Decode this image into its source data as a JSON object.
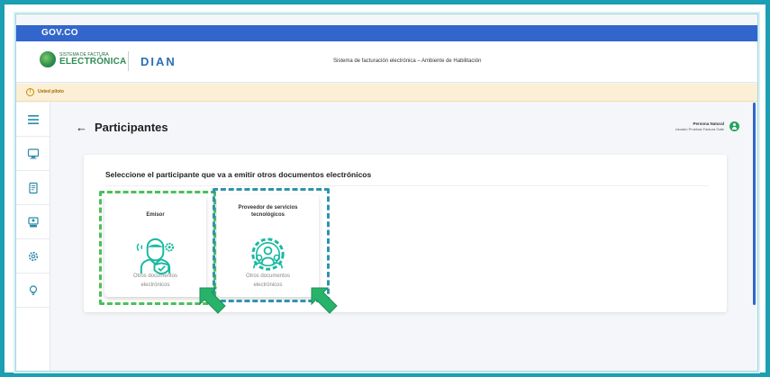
{
  "gov_bar": {
    "logo_text": "GOV.CO"
  },
  "header": {
    "fe_logo": {
      "line1": "SISTEMA DE FACTURA",
      "line2": "ELECTRÓNICA",
      "line3": ""
    },
    "dian_logo": "DIAN",
    "system_title": "Sistema de facturación electrónica – Ambiente de Habilitación"
  },
  "warning_bar": {
    "text": "Usted piloto"
  },
  "sidebar": {
    "items": [
      {
        "icon": "menu-icon"
      },
      {
        "icon": "monitor-icon"
      },
      {
        "icon": "document-icon"
      },
      {
        "icon": "users-icon"
      },
      {
        "icon": "gear-icon"
      },
      {
        "icon": "lightbulb-icon"
      }
    ]
  },
  "page": {
    "title": "Participantes",
    "user": {
      "role": "Persona Natural",
      "name": "Usuario Pruebas Factura Gate"
    }
  },
  "selection": {
    "prompt": "Seleccione el participante que va a emitir otros documentos electrónicos",
    "options": [
      {
        "title": "Emisor",
        "description_line1": "Otros documentos",
        "description_line2": "electrónicos",
        "icon": "emisor-person-icon"
      },
      {
        "title_line1": "Proveedor de servicios",
        "title_line2": "tecnológicos",
        "description_line1": "Otros documentos",
        "description_line2": "electrónicos",
        "icon": "provider-group-gear-icon"
      }
    ]
  },
  "colors": {
    "gov_blue": "#3366cc",
    "frame_teal": "#1a9fb3",
    "highlight_green": "#4cbf5a",
    "highlight_blue": "#2e93b0",
    "icon_teal": "#18b9a0"
  }
}
